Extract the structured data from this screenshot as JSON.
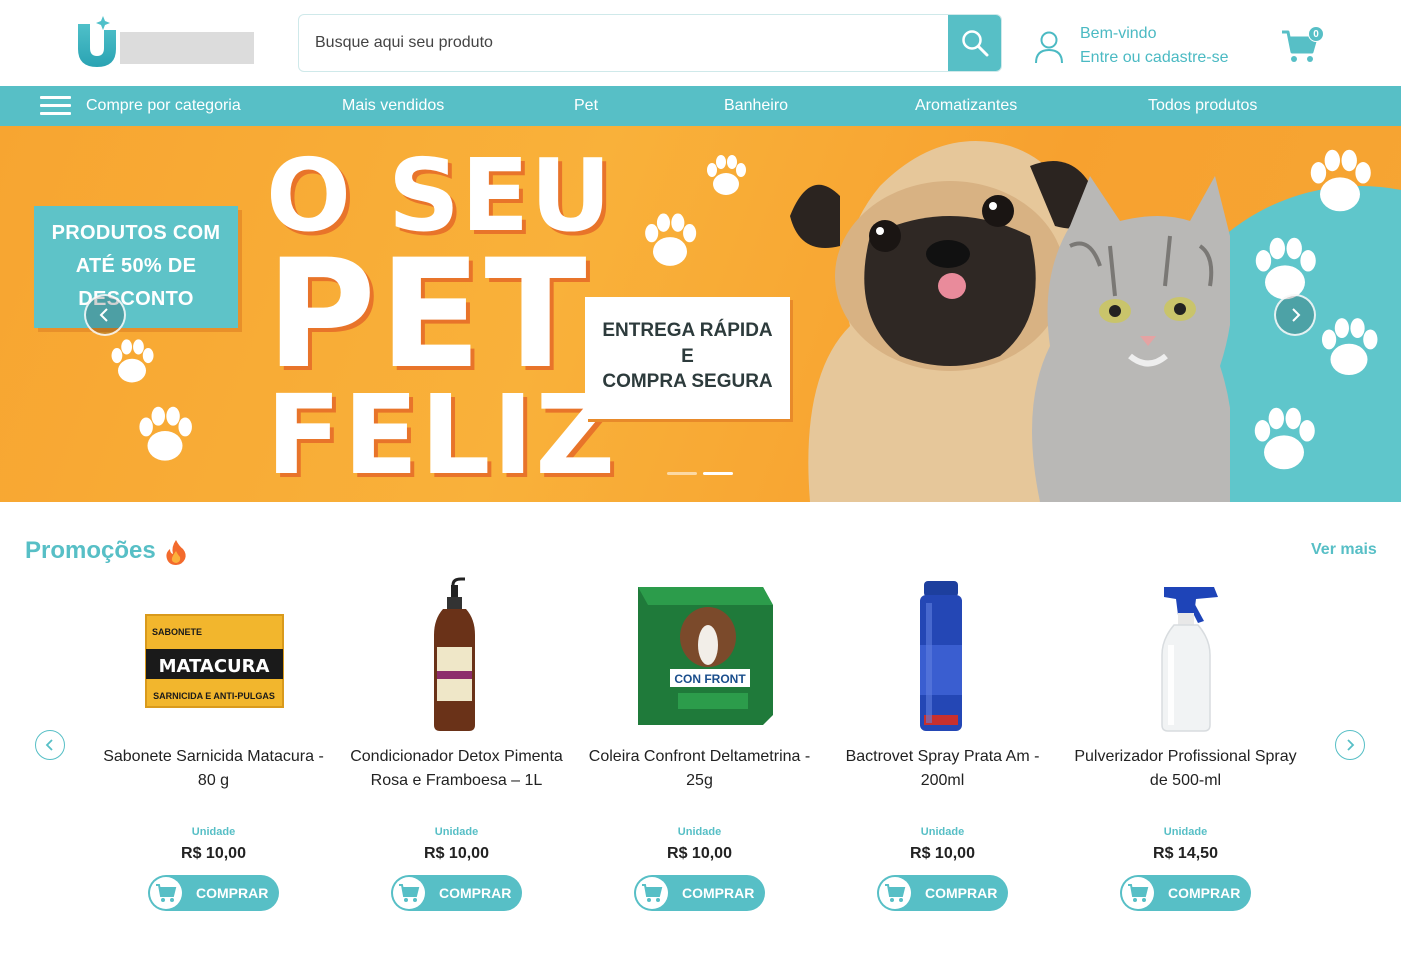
{
  "header": {
    "search_placeholder": "Busque aqui seu produto",
    "user_greeting": "Bem-vindo",
    "user_action": "Entre ou cadastre-se",
    "cart_count": "0"
  },
  "nav": {
    "items": [
      {
        "label": "Compre por categoria"
      },
      {
        "label": "Mais vendidos"
      },
      {
        "label": "Pet"
      },
      {
        "label": "Banheiro"
      },
      {
        "label": "Aromatizantes"
      },
      {
        "label": "Todos produtos"
      }
    ]
  },
  "banner": {
    "promo_lines": [
      "PRODUTOS COM",
      "ATÉ 50% DE",
      "DESCONTO"
    ],
    "headline_1": "O SEU",
    "headline_2": "PET",
    "headline_3": "FELIZ",
    "delivery_lines": [
      "ENTREGA RÁPIDA",
      "E",
      "COMPRA SEGURA"
    ],
    "active_slide": 2,
    "total_slides": 2
  },
  "promotions": {
    "title": "Promoções",
    "see_more": "Ver mais",
    "products": [
      {
        "name": "Sabonete Sarnicida Matacura - 80 g",
        "unit": "Unidade",
        "price": "R$ 10,00",
        "button": "COMPRAR",
        "box_top": "SABONETE",
        "box_brand": "MATACURA",
        "box_bottom": "SARNICIDA E ANTI-PULGAS"
      },
      {
        "name": "Condicionador Detox Pimenta Rosa e Framboesa – 1L",
        "unit": "Unidade",
        "price": "R$ 10,00",
        "button": "COMPRAR"
      },
      {
        "name": "Coleira Confront Deltametrina - 25g",
        "unit": "Unidade",
        "price": "R$ 10,00",
        "button": "COMPRAR",
        "box_brand": "CON FRONT"
      },
      {
        "name": "Bactrovet Spray Prata Am - 200ml",
        "unit": "Unidade",
        "price": "R$ 10,00",
        "button": "COMPRAR"
      },
      {
        "name": "Pulverizador Profissional Spray de 500-ml",
        "unit": "Unidade",
        "price": "R$ 14,50",
        "button": "COMPRAR"
      }
    ]
  },
  "colors": {
    "accent": "#57bfc6",
    "banner_orange": "#f7a531",
    "text": "#222222"
  }
}
